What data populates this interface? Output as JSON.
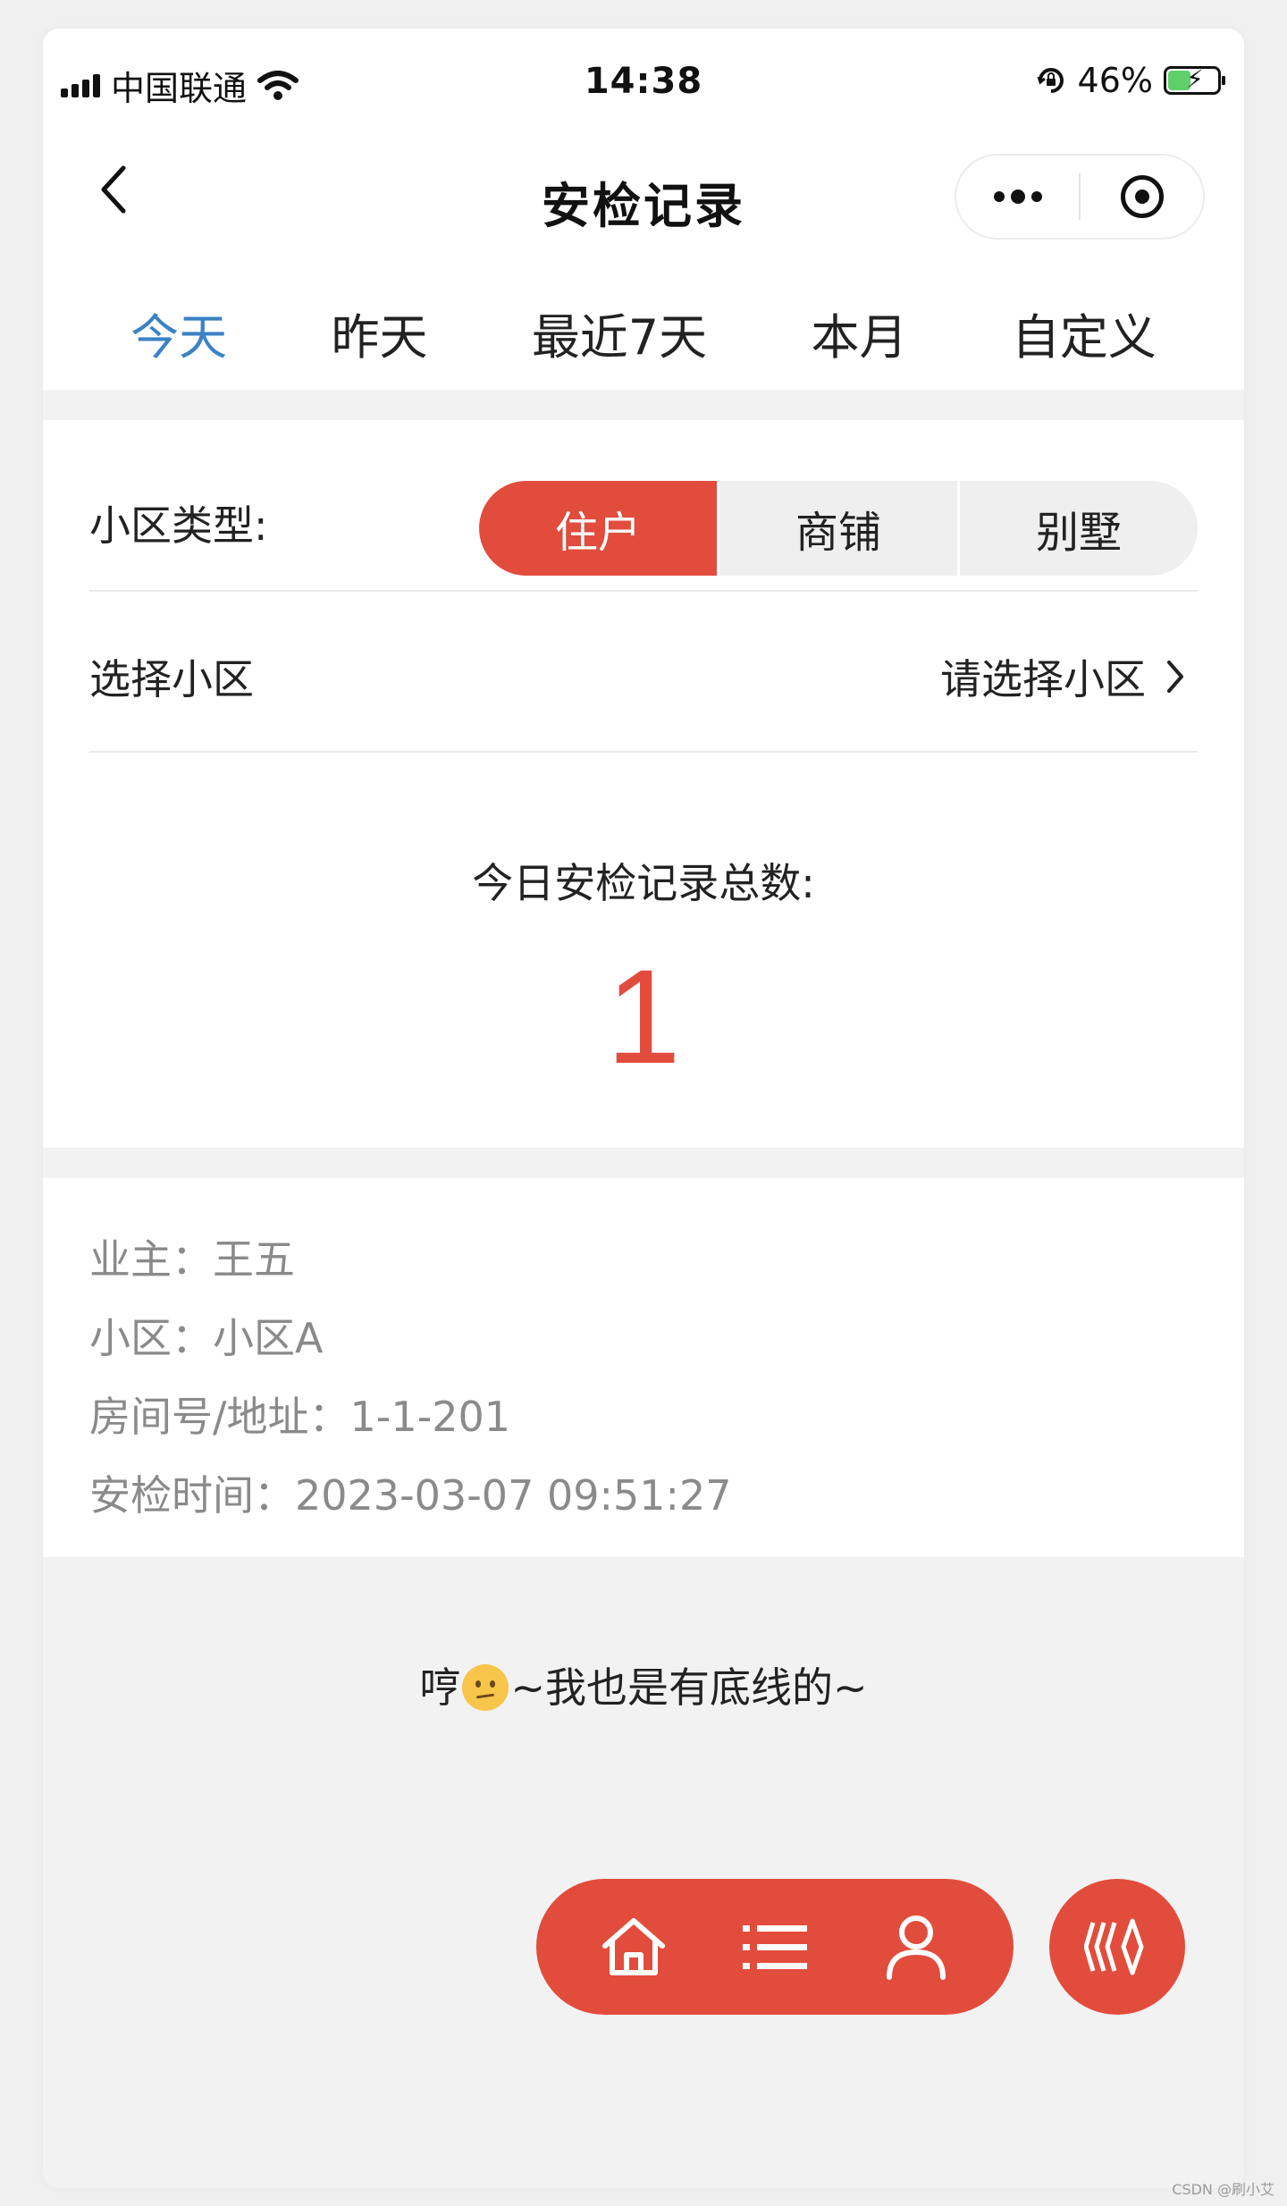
{
  "status_bar": {
    "carrier": "中国联通",
    "time": "14:38",
    "battery": "46%",
    "battery_level": 0.46
  },
  "nav": {
    "title": "安检记录"
  },
  "tabs": [
    {
      "label": "今天",
      "active": true
    },
    {
      "label": "昨天",
      "active": false
    },
    {
      "label": "最近7天",
      "active": false
    },
    {
      "label": "本月",
      "active": false
    },
    {
      "label": "自定义",
      "active": false
    }
  ],
  "filters": {
    "type_label": "小区类型:",
    "type_options": [
      "住户",
      "商铺",
      "别墅"
    ],
    "type_selected": "住户",
    "community_label": "选择小区",
    "community_placeholder": "请选择小区"
  },
  "summary": {
    "label": "今日安检记录总数:",
    "count": "1"
  },
  "record": {
    "owner": "业主：王五",
    "community": "小区：小区A",
    "address": "房间号/地址：1-1-201",
    "time": "安检时间：2023-03-07 09:51:27"
  },
  "bottom": {
    "prefix": "哼",
    "emoji_name": "confused-face-icon",
    "suffix": "~我也是有底线的~"
  },
  "fab": {
    "icons": [
      "home-icon",
      "list-icon",
      "user-icon"
    ],
    "round_icon": "brand-logo-icon"
  },
  "watermark": "CSDN @刷小艾",
  "colors": {
    "accent": "#e24c3c",
    "tab_active": "#3b82c4",
    "muted_text": "#8a8a8a",
    "band": "#f2f2f2"
  }
}
